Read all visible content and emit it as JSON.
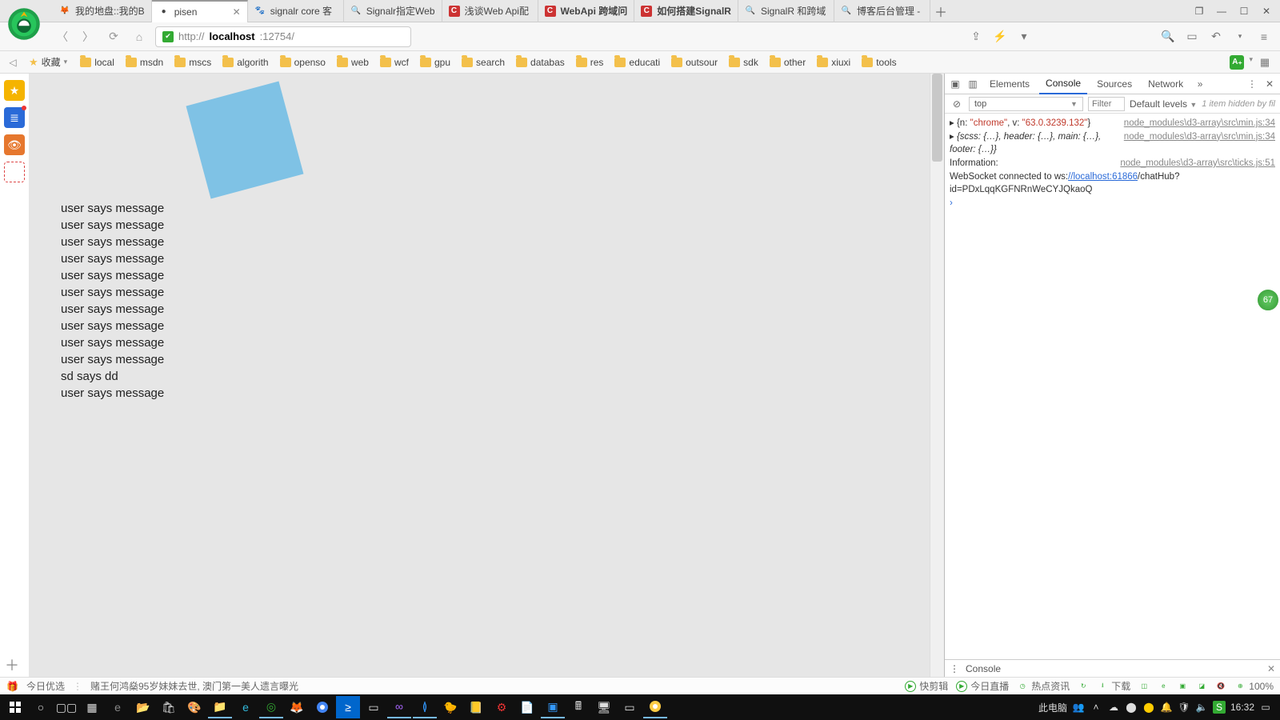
{
  "tabs": [
    {
      "label": "我的地盘::我的B",
      "icon": "firefox"
    },
    {
      "label": "pisen",
      "icon": "dot",
      "active": true,
      "close": true
    },
    {
      "label": "signalr core 客",
      "icon": "baidu"
    },
    {
      "label": "Signalr指定Web",
      "icon": "mag"
    },
    {
      "label": "浅谈Web Api配",
      "icon": "cnblogs"
    },
    {
      "label": "WebApi 跨域问",
      "icon": "cnblogs-red",
      "bold": true
    },
    {
      "label": "如何搭建SignalR",
      "icon": "cnblogs-red",
      "bold": true
    },
    {
      "label": "SignalR 和跨域",
      "icon": "mag"
    },
    {
      "label": "博客后台管理 -",
      "icon": "mag"
    }
  ],
  "window_controls": {
    "clone": "❐",
    "min": "—",
    "max": "☐",
    "close": "✕"
  },
  "addr": {
    "url_prefix": "http://",
    "url_host": "localhost",
    "url_port": ":12754/",
    "share": "share",
    "bolt": "⚡",
    "chev": "▾",
    "search": "search",
    "device": "▭",
    "undo": "↶",
    "menu": "≡"
  },
  "bookmarks": {
    "fav_label": "收藏 ",
    "items": [
      "local",
      "msdn",
      "mscs",
      "algorith",
      "openso",
      "web",
      "wcf",
      "gpu",
      "search",
      "databas",
      "res",
      "educati",
      "outsour",
      "sdk",
      "other",
      "xiuxi",
      "tools"
    ]
  },
  "side": [
    "star",
    "news",
    "weibo",
    "mail"
  ],
  "page": {
    "messages": [
      "user says message",
      "user says message",
      "user says message",
      "user says message",
      "user says message",
      "user says message",
      "user says message",
      "user says message",
      "user says message",
      "user says message",
      "sd says dd",
      "user says message"
    ]
  },
  "fps": "67",
  "devtools": {
    "tabs": [
      "Elements",
      "Console",
      "Sources",
      "Network"
    ],
    "active": "Console",
    "more": "»",
    "context": "top",
    "filter_placeholder": "Filter",
    "levels": "Default levels",
    "hidden": "1 item hidden by fil",
    "src1": "node_modules\\d3-array\\src\\min.js:34",
    "obj1_pre": "{n: ",
    "obj1_n": "\"chrome\"",
    "obj1_mid": ", v: ",
    "obj1_v": "\"63.0.3239.132\"",
    "obj1_post": "}",
    "src2": "node_modules\\d3-array\\src\\min.js:34",
    "obj2": "{scss: {…}, header: {…}, main: {…}, footer: {…}}",
    "src3": "node_modules\\d3-array\\src\\ticks.js:51",
    "info_label": "Information:",
    "ws1": "WebSocket connected to ws:",
    "ws_link": "//localhost:61866",
    "ws2": "/chatHub?id=PDxLqqKGFNRnWeCYJQkaoQ",
    "drawer": "Console"
  },
  "status": {
    "left_icon": "今日优选",
    "news": "赌王何鸿燊95岁妹妹去世, 澳门第一美人遗言曝光",
    "right": [
      {
        "icon": "▶",
        "label": "快剪辑"
      },
      {
        "icon": "▶",
        "label": "今日直播"
      },
      {
        "icon": "◷",
        "label": "热点资讯"
      },
      {
        "icon": "↻",
        "label": ""
      },
      {
        "icon": "⭳",
        "label": "下载"
      },
      {
        "icon": "◫",
        "label": ""
      },
      {
        "icon": "e",
        "label": ""
      },
      {
        "icon": "▣",
        "label": ""
      },
      {
        "icon": "◪",
        "label": ""
      },
      {
        "icon": "🔇",
        "label": ""
      },
      {
        "icon": "⊕",
        "label": "100%"
      }
    ]
  },
  "taskbar": {
    "tray_label": "此电脑",
    "clock": "16:32"
  }
}
